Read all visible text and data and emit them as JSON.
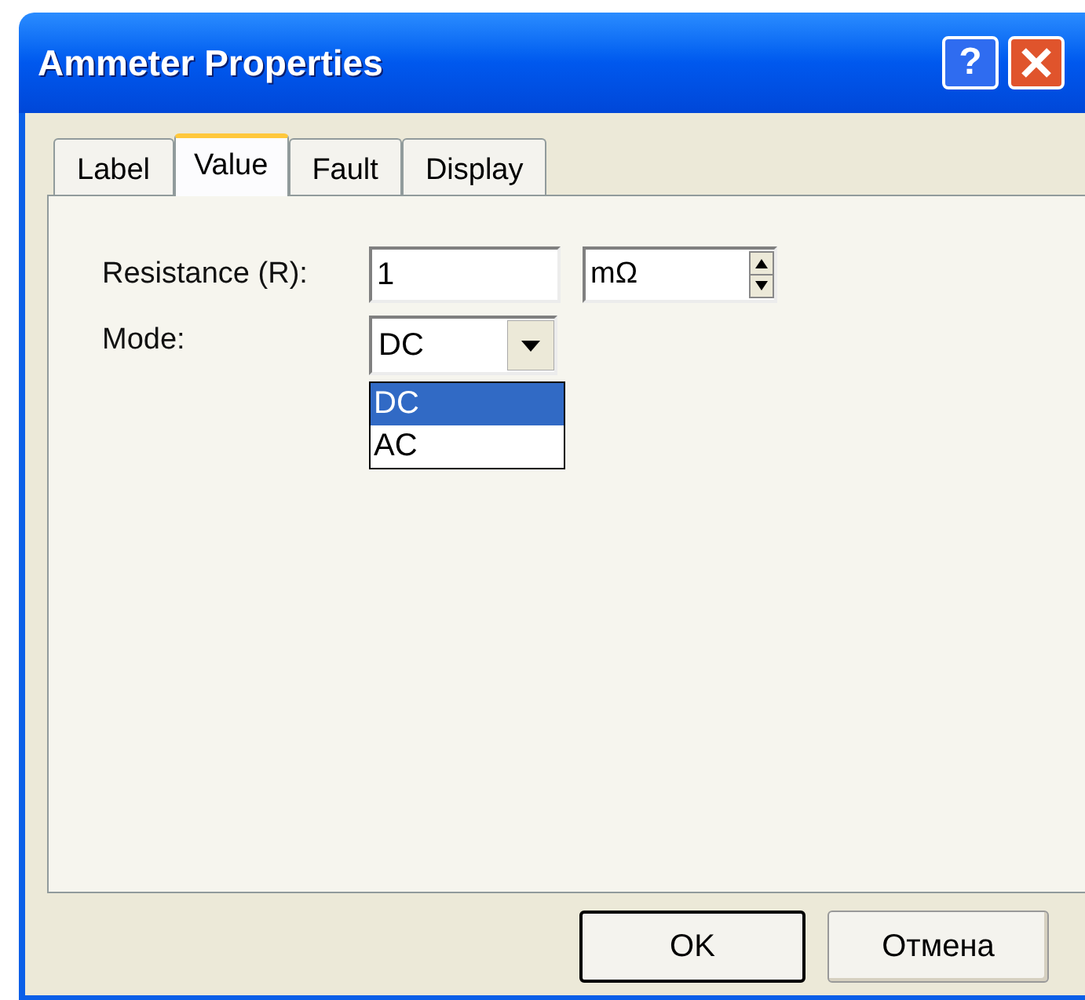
{
  "window": {
    "title": "Ammeter Properties",
    "help": "?"
  },
  "tabs": [
    {
      "label": "Label",
      "selected": false
    },
    {
      "label": "Value",
      "selected": true
    },
    {
      "label": "Fault",
      "selected": false
    },
    {
      "label": "Display",
      "selected": false
    }
  ],
  "resistance": {
    "label": "Resistance (R):",
    "value": "1",
    "unit": "mΩ"
  },
  "mode": {
    "label": "Mode:",
    "value": "DC",
    "options": [
      {
        "label": "DC",
        "selected": true
      },
      {
        "label": "AC",
        "selected": false
      }
    ]
  },
  "buttons": [
    {
      "label": "OK",
      "default": true
    },
    {
      "label": "Отмена",
      "default": false
    }
  ]
}
